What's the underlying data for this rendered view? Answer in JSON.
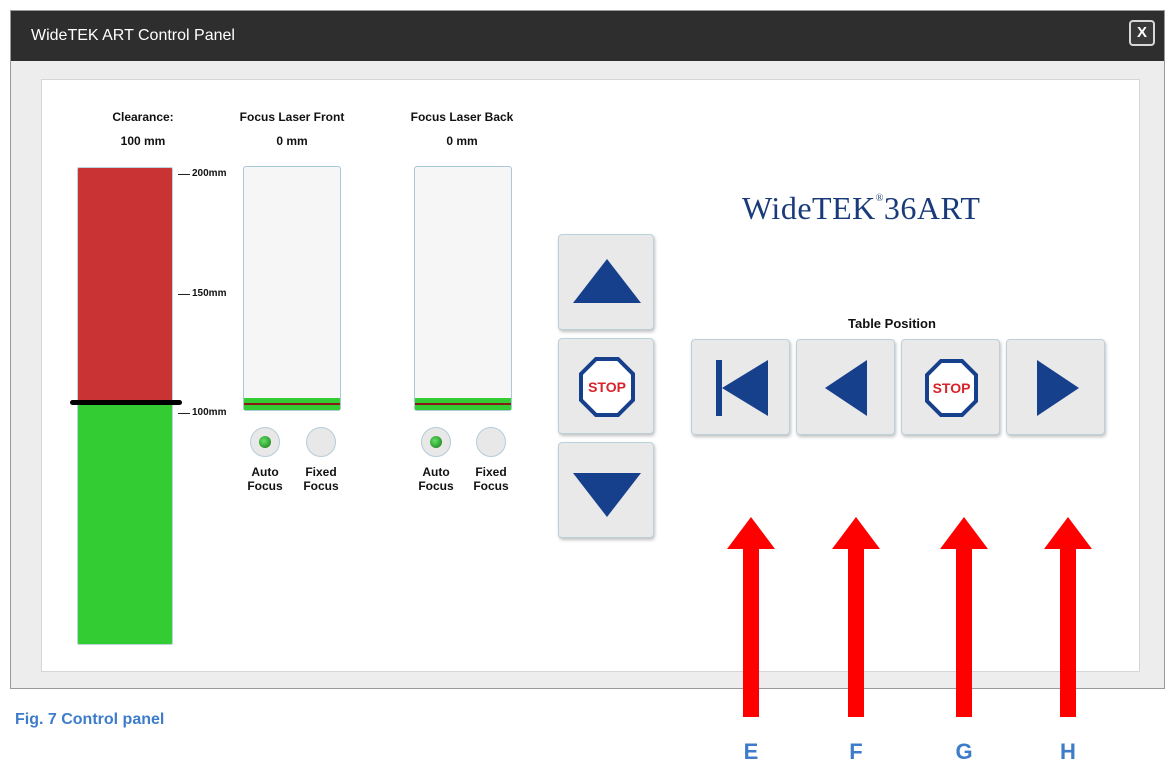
{
  "window": {
    "title": "WideTEK ART Control Panel",
    "close_label": "X"
  },
  "clearance": {
    "label": "Clearance:",
    "value": "100 mm",
    "ticks": [
      "200mm",
      "150mm",
      "100mm"
    ],
    "level_fraction": 0.5,
    "colors": {
      "above": "#c93333",
      "below": "#33cc33"
    }
  },
  "focus_front": {
    "label": "Focus Laser Front",
    "value": "0 mm",
    "auto_label": "Auto Focus",
    "fixed_label": "Fixed Focus",
    "selected": "auto"
  },
  "focus_back": {
    "label": "Focus Laser Back",
    "value": "0 mm",
    "auto_label": "Auto Focus",
    "fixed_label": "Fixed Focus",
    "selected": "auto"
  },
  "vertical_controls": {
    "up_icon": "triangle-up-icon",
    "stop_label": "STOP",
    "down_icon": "triangle-down-icon"
  },
  "logo": {
    "brand": "WideTEK",
    "mark": "®",
    "model": "36ART"
  },
  "table_position": {
    "label": "Table Position",
    "stop_label": "STOP",
    "buttons": [
      "skip-to-start-icon",
      "triangle-left-icon",
      "stop-icon",
      "triangle-right-icon"
    ]
  },
  "caption": "Fig. 7  Control panel",
  "callouts": [
    "E",
    "F",
    "G",
    "H"
  ],
  "colors": {
    "accent_blue": "#163f8c",
    "stop_red": "#d8232a",
    "callout_red": "#ff0000",
    "caption_blue": "#3d7cc9"
  }
}
